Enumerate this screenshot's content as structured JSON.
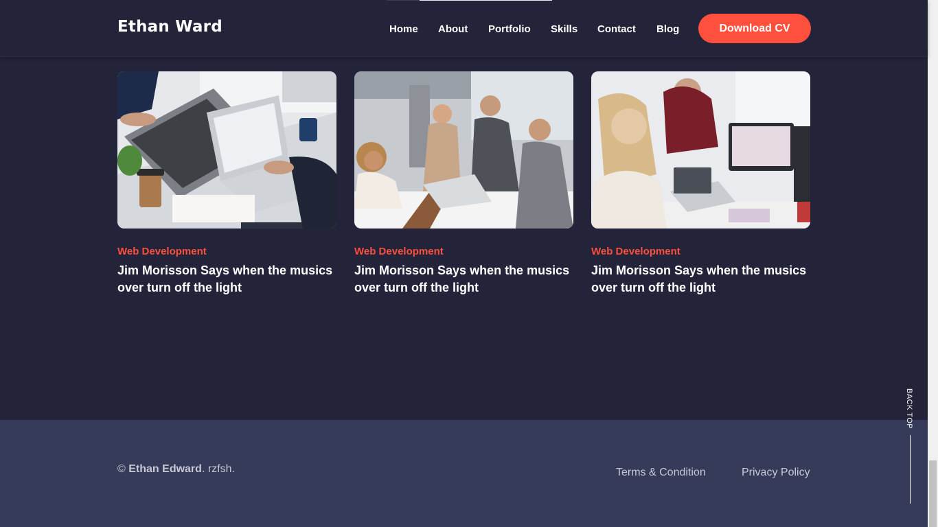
{
  "header": {
    "logo": "Ethan Ward",
    "nav": [
      "Home",
      "About",
      "Portfolio",
      "Skills",
      "Contact",
      "Blog"
    ],
    "cta": "Download CV"
  },
  "posts": [
    {
      "category": "Web Development",
      "title": "Jim Morisson Says when the musics over turn off the light",
      "image": "laptops-on-desk-photo"
    },
    {
      "category": "Web Development",
      "title": "Jim Morisson Says when the musics over turn off the light",
      "image": "team-meeting-photo"
    },
    {
      "category": "Web Development",
      "title": "Jim Morisson Says when the musics over turn off the light",
      "image": "designers-at-monitor-photo"
    }
  ],
  "footer": {
    "copyright_symbol": "©",
    "copyright_name": "Ethan Edward",
    "copyright_suffix": ". rzfsh.",
    "links": [
      "Terms & Condition",
      "Privacy Policy"
    ]
  },
  "back_top": "BACK TOP",
  "colors": {
    "background": "#23233a",
    "footer": "#353b58",
    "accent": "#ff4f3d",
    "text": "#ffffff",
    "muted": "#c7c9d6"
  }
}
